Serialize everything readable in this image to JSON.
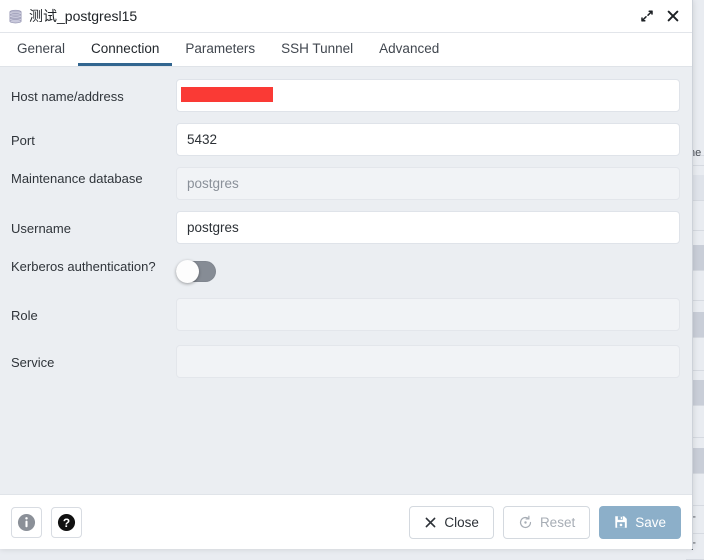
{
  "window": {
    "title": "测试_postgresl15",
    "icon": "server-icon",
    "maximize_label": "Maximize",
    "close_label": "Close"
  },
  "tabs": [
    {
      "label": "General",
      "active": false
    },
    {
      "label": "Connection",
      "active": true
    },
    {
      "label": "Parameters",
      "active": false
    },
    {
      "label": "SSH Tunnel",
      "active": false
    },
    {
      "label": "Advanced",
      "active": false
    }
  ],
  "form": {
    "host": {
      "label": "Host name/address",
      "value": "",
      "redacted": true,
      "placeholder": ""
    },
    "port": {
      "label": "Port",
      "value": "5432",
      "placeholder": ""
    },
    "maintenance_db": {
      "label": "Maintenance database",
      "value": "",
      "placeholder": "postgres",
      "disabled": true
    },
    "username": {
      "label": "Username",
      "value": "postgres",
      "placeholder": ""
    },
    "kerberos": {
      "label": "Kerberos authentication?",
      "state": "off"
    },
    "role": {
      "label": "Role",
      "value": "",
      "placeholder": "",
      "disabled": true
    },
    "service": {
      "label": "Service",
      "value": "",
      "placeholder": "",
      "disabled": true
    }
  },
  "footer": {
    "info_label": "Info",
    "help_label": "Help",
    "close_label": "Close",
    "reset_label": "Reset",
    "save_label": "Save"
  },
  "colors": {
    "accent": "#326690",
    "primary_button": "#8cafc9",
    "redaction": "#fa3a35",
    "toggle_off": "#868c95",
    "dialog_bg": "#ebeef2"
  },
  "backdrop": {
    "rows": [
      "",
      "ne",
      "",
      "",
      "",
      "",
      "",
      "",
      "",
      "",
      "",
      "",
      "",
      "",
      "",
      "T",
      "T"
    ]
  }
}
